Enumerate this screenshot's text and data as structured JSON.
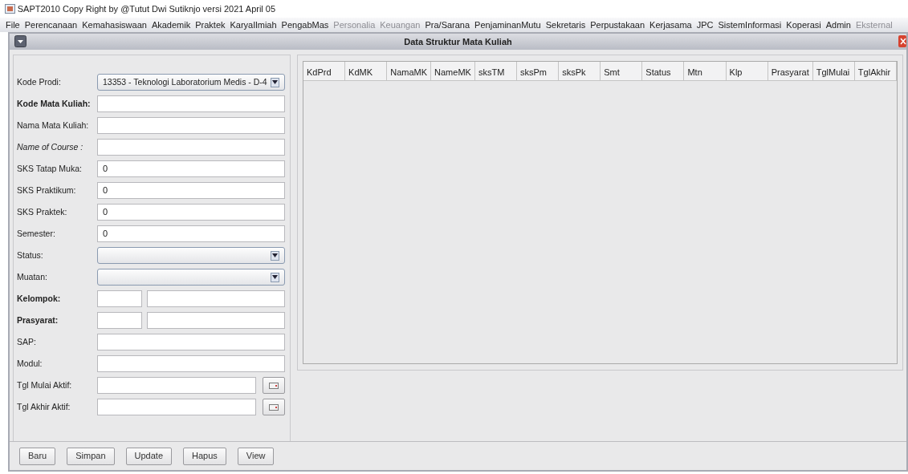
{
  "window": {
    "title": "SAPT2010 Copy Right by @Tutut Dwi Sutiknjo versi 2021 April 05"
  },
  "menu": [
    {
      "label": "File",
      "disabled": false
    },
    {
      "label": "Perencanaan",
      "disabled": false
    },
    {
      "label": "Kemahasiswaan",
      "disabled": false
    },
    {
      "label": "Akademik",
      "disabled": false
    },
    {
      "label": "Praktek",
      "disabled": false
    },
    {
      "label": "KaryaIlmiah",
      "disabled": false
    },
    {
      "label": "PengabMas",
      "disabled": false
    },
    {
      "label": "Personalia",
      "disabled": true
    },
    {
      "label": "Keuangan",
      "disabled": true
    },
    {
      "label": "Pra/Sarana",
      "disabled": false
    },
    {
      "label": "PenjaminanMutu",
      "disabled": false
    },
    {
      "label": "Sekretaris",
      "disabled": false
    },
    {
      "label": "Perpustakaan",
      "disabled": false
    },
    {
      "label": "Kerjasama",
      "disabled": false
    },
    {
      "label": "JPC",
      "disabled": false
    },
    {
      "label": "SistemInformasi",
      "disabled": false
    },
    {
      "label": "Koperasi",
      "disabled": false
    },
    {
      "label": "Admin",
      "disabled": false
    },
    {
      "label": "Eksternal",
      "disabled": true
    }
  ],
  "frame": {
    "title": "Data Struktur Mata Kuliah"
  },
  "form": [
    {
      "label": "Kode Prodi:",
      "bold": false,
      "italic": false,
      "kind": "combo",
      "value": "13353 - Teknologi Laboratorium Medis - D-4"
    },
    {
      "label": "Kode  Mata Kuliah:",
      "bold": true,
      "italic": false,
      "kind": "text"
    },
    {
      "label": "Nama Mata Kuliah:",
      "bold": false,
      "italic": false,
      "kind": "text"
    },
    {
      "label": "Name of Course :",
      "bold": false,
      "italic": true,
      "kind": "text"
    },
    {
      "label": "SKS Tatap Muka:",
      "bold": false,
      "italic": false,
      "kind": "text",
      "value": "0"
    },
    {
      "label": "SKS Praktikum:",
      "bold": false,
      "italic": false,
      "kind": "text",
      "value": "0"
    },
    {
      "label": "SKS Praktek:",
      "bold": false,
      "italic": false,
      "kind": "text",
      "value": "0"
    },
    {
      "label": "Semester:",
      "bold": false,
      "italic": false,
      "kind": "text",
      "value": "0"
    },
    {
      "label": "Status:",
      "bold": false,
      "italic": false,
      "kind": "combo"
    },
    {
      "label": "Muatan:",
      "bold": false,
      "italic": false,
      "kind": "combo"
    },
    {
      "label": "Kelompok:",
      "bold": true,
      "italic": false,
      "kind": "pair"
    },
    {
      "label": "Prasyarat:",
      "bold": true,
      "italic": false,
      "kind": "pair"
    },
    {
      "label": "SAP:",
      "bold": false,
      "italic": false,
      "kind": "text"
    },
    {
      "label": "Modul:",
      "bold": false,
      "italic": false,
      "kind": "text"
    },
    {
      "label": "Tgl Mulai Aktif:",
      "bold": false,
      "italic": false,
      "kind": "date"
    },
    {
      "label": "Tgl Akhir Aktif:",
      "bold": false,
      "italic": false,
      "kind": "date"
    }
  ],
  "table": {
    "columns": [
      "KdPrd",
      "KdMK",
      "NamaMK",
      "NameMK",
      "sksTM",
      "sksPm",
      "sksPk",
      "Smt",
      "Status",
      "Mtn",
      "Klp",
      "Prasyarat",
      "TglMulai",
      "TglAkhir"
    ]
  },
  "buttons": [
    "Baru",
    "Simpan",
    "Update",
    "Hapus",
    "View"
  ]
}
